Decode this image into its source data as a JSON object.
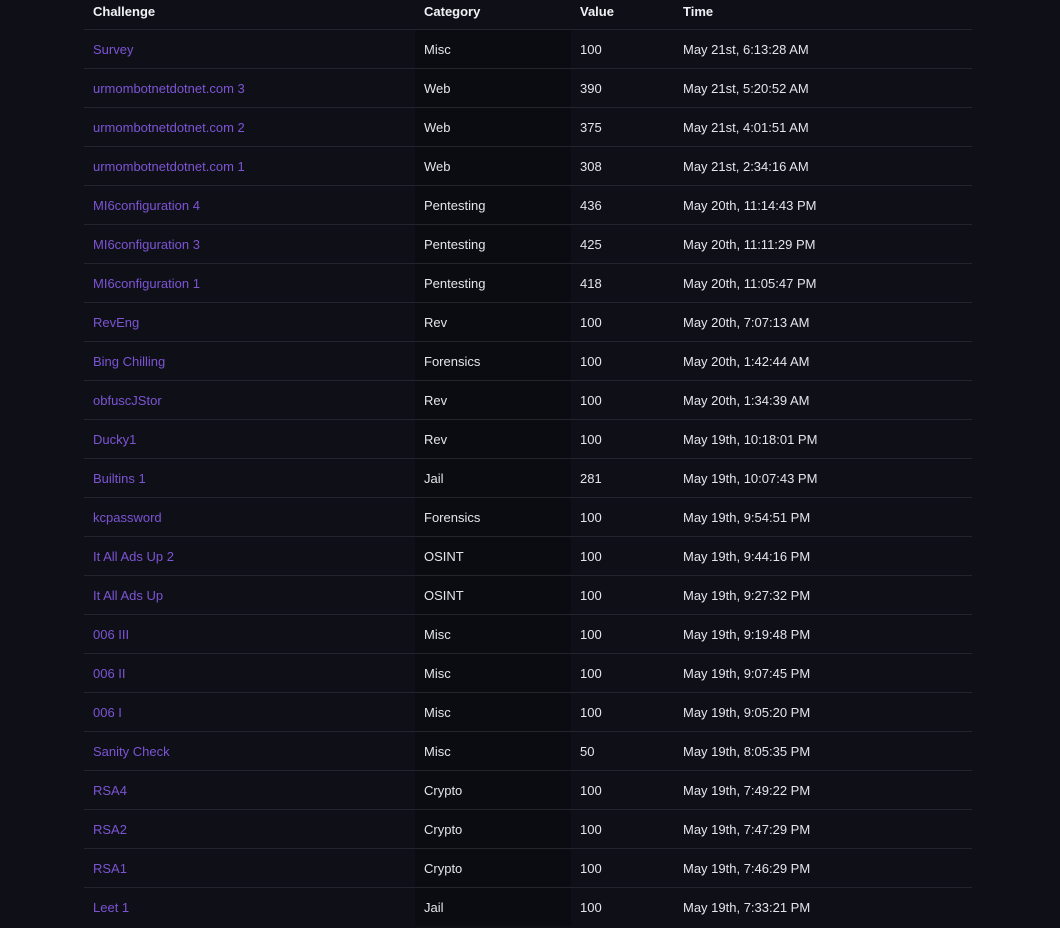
{
  "table": {
    "headers": {
      "challenge": "Challenge",
      "category": "Category",
      "value": "Value",
      "time": "Time"
    },
    "rows": [
      {
        "challenge": "Survey",
        "category": "Misc",
        "value": "100",
        "time": "May 21st, 6:13:28 AM"
      },
      {
        "challenge": "urmombotnetdotnet.com 3",
        "category": "Web",
        "value": "390",
        "time": "May 21st, 5:20:52 AM"
      },
      {
        "challenge": "urmombotnetdotnet.com 2",
        "category": "Web",
        "value": "375",
        "time": "May 21st, 4:01:51 AM"
      },
      {
        "challenge": "urmombotnetdotnet.com 1",
        "category": "Web",
        "value": "308",
        "time": "May 21st, 2:34:16 AM"
      },
      {
        "challenge": "MI6configuration 4",
        "category": "Pentesting",
        "value": "436",
        "time": "May 20th, 11:14:43 PM"
      },
      {
        "challenge": "MI6configuration 3",
        "category": "Pentesting",
        "value": "425",
        "time": "May 20th, 11:11:29 PM"
      },
      {
        "challenge": "MI6configuration 1",
        "category": "Pentesting",
        "value": "418",
        "time": "May 20th, 11:05:47 PM"
      },
      {
        "challenge": "RevEng",
        "category": "Rev",
        "value": "100",
        "time": "May 20th, 7:07:13 AM"
      },
      {
        "challenge": "Bing Chilling",
        "category": "Forensics",
        "value": "100",
        "time": "May 20th, 1:42:44 AM"
      },
      {
        "challenge": "obfuscJStor",
        "category": "Rev",
        "value": "100",
        "time": "May 20th, 1:34:39 AM"
      },
      {
        "challenge": "Ducky1",
        "category": "Rev",
        "value": "100",
        "time": "May 19th, 10:18:01 PM"
      },
      {
        "challenge": "Builtins 1",
        "category": "Jail",
        "value": "281",
        "time": "May 19th, 10:07:43 PM"
      },
      {
        "challenge": "kcpassword",
        "category": "Forensics",
        "value": "100",
        "time": "May 19th, 9:54:51 PM"
      },
      {
        "challenge": "It All Ads Up 2",
        "category": "OSINT",
        "value": "100",
        "time": "May 19th, 9:44:16 PM"
      },
      {
        "challenge": "It All Ads Up",
        "category": "OSINT",
        "value": "100",
        "time": "May 19th, 9:27:32 PM"
      },
      {
        "challenge": "006 III",
        "category": "Misc",
        "value": "100",
        "time": "May 19th, 9:19:48 PM"
      },
      {
        "challenge": "006 II",
        "category": "Misc",
        "value": "100",
        "time": "May 19th, 9:07:45 PM"
      },
      {
        "challenge": "006 I",
        "category": "Misc",
        "value": "100",
        "time": "May 19th, 9:05:20 PM"
      },
      {
        "challenge": "Sanity Check",
        "category": "Misc",
        "value": "50",
        "time": "May 19th, 8:05:35 PM"
      },
      {
        "challenge": "RSA4",
        "category": "Crypto",
        "value": "100",
        "time": "May 19th, 7:49:22 PM"
      },
      {
        "challenge": "RSA2",
        "category": "Crypto",
        "value": "100",
        "time": "May 19th, 7:47:29 PM"
      },
      {
        "challenge": "RSA1",
        "category": "Crypto",
        "value": "100",
        "time": "May 19th, 7:46:29 PM"
      },
      {
        "challenge": "Leet 1",
        "category": "Jail",
        "value": "100",
        "time": "May 19th, 7:33:21 PM"
      }
    ]
  },
  "colors": {
    "background": "#0f0f17",
    "link": "#7c54d4",
    "text": "#e4e4ea",
    "divider": "#24242e"
  }
}
